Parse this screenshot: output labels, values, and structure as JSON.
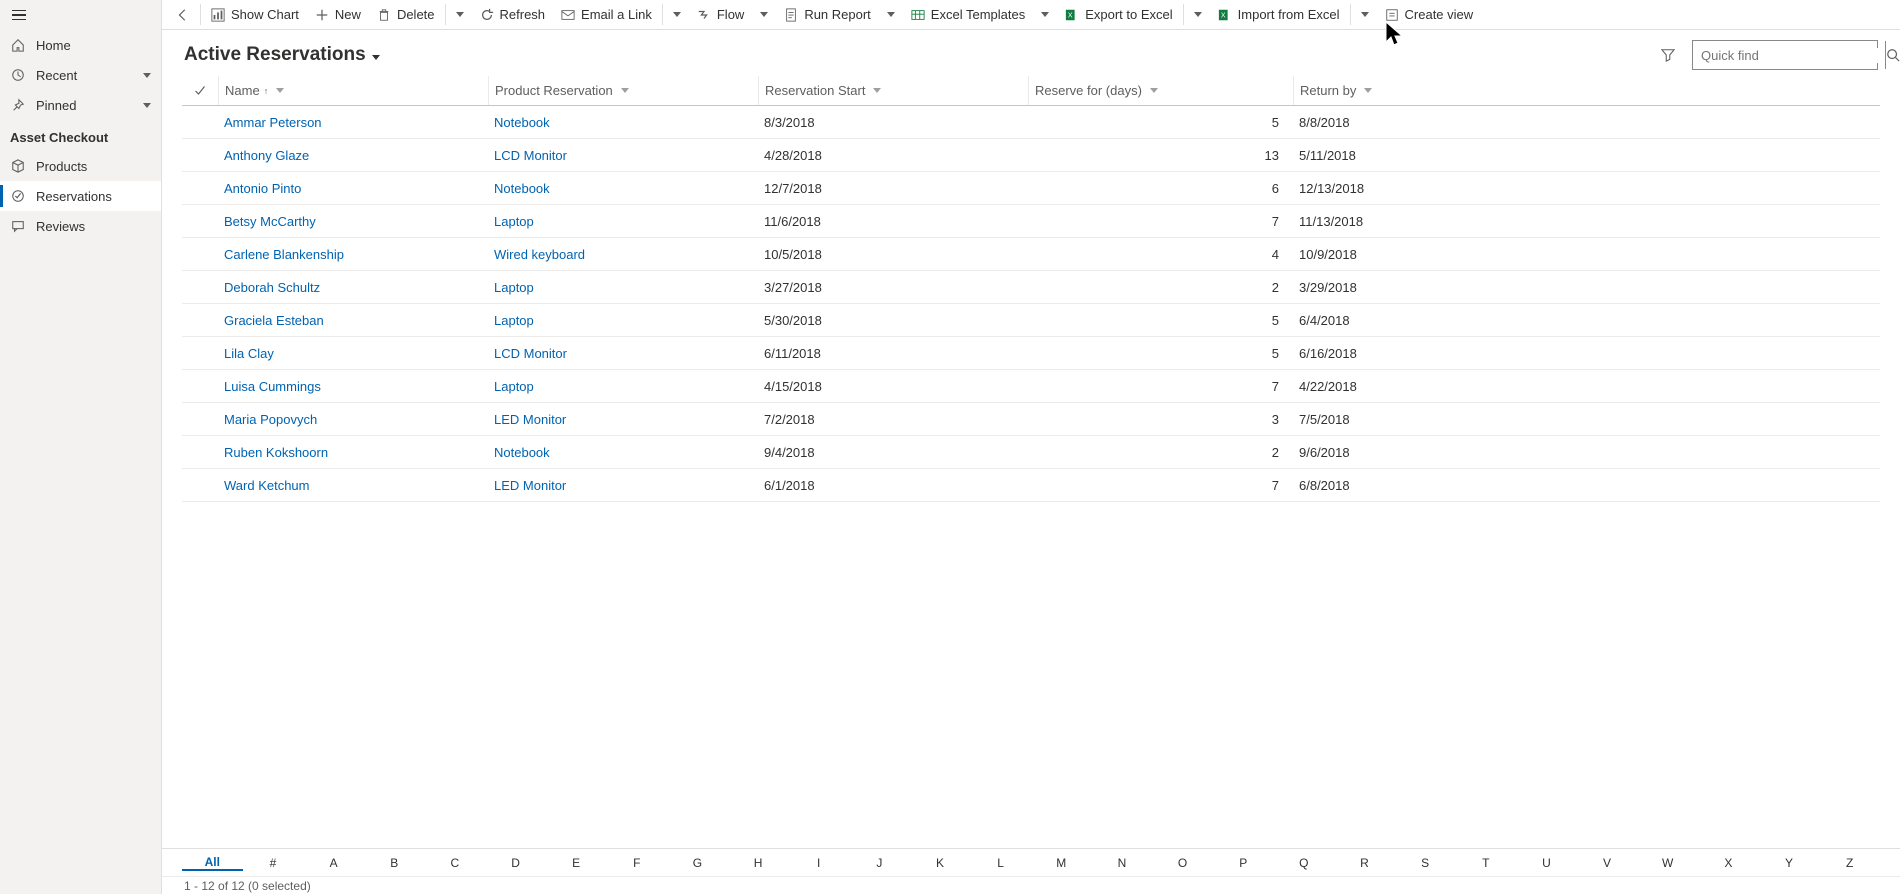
{
  "sidebar": {
    "nav": [
      {
        "icon": "home",
        "label": "Home"
      },
      {
        "icon": "clock",
        "label": "Recent",
        "chevron": true
      },
      {
        "icon": "pin",
        "label": "Pinned",
        "chevron": true
      }
    ],
    "section_label": "Asset Checkout",
    "area": [
      {
        "icon": "cube",
        "label": "Products"
      },
      {
        "icon": "check-circle",
        "label": "Reservations",
        "active": true
      },
      {
        "icon": "comment",
        "label": "Reviews"
      }
    ]
  },
  "toolbar": {
    "show_chart": "Show Chart",
    "new": "New",
    "delete": "Delete",
    "refresh": "Refresh",
    "email": "Email a Link",
    "flow": "Flow",
    "run_report": "Run Report",
    "excel_templates": "Excel Templates",
    "export_excel": "Export to Excel",
    "import_excel": "Import from Excel",
    "create_view": "Create view"
  },
  "header": {
    "view_title": "Active Reservations",
    "quickfind_placeholder": "Quick find"
  },
  "columns": {
    "name": "Name",
    "product": "Product Reservation",
    "start": "Reservation Start",
    "days": "Reserve for (days)",
    "return": "Return by"
  },
  "rows": [
    {
      "name": "Ammar Peterson",
      "product": "Notebook",
      "start": "8/3/2018",
      "days": "5",
      "return": "8/8/2018"
    },
    {
      "name": "Anthony Glaze",
      "product": "LCD Monitor",
      "start": "4/28/2018",
      "days": "13",
      "return": "5/11/2018"
    },
    {
      "name": "Antonio Pinto",
      "product": "Notebook",
      "start": "12/7/2018",
      "days": "6",
      "return": "12/13/2018"
    },
    {
      "name": "Betsy McCarthy",
      "product": "Laptop",
      "start": "11/6/2018",
      "days": "7",
      "return": "11/13/2018"
    },
    {
      "name": "Carlene Blankenship",
      "product": "Wired keyboard",
      "start": "10/5/2018",
      "days": "4",
      "return": "10/9/2018"
    },
    {
      "name": "Deborah Schultz",
      "product": "Laptop",
      "start": "3/27/2018",
      "days": "2",
      "return": "3/29/2018"
    },
    {
      "name": "Graciela Esteban",
      "product": "Laptop",
      "start": "5/30/2018",
      "days": "5",
      "return": "6/4/2018"
    },
    {
      "name": "Lila Clay",
      "product": "LCD Monitor",
      "start": "6/11/2018",
      "days": "5",
      "return": "6/16/2018"
    },
    {
      "name": "Luisa Cummings",
      "product": "Laptop",
      "start": "4/15/2018",
      "days": "7",
      "return": "4/22/2018"
    },
    {
      "name": "Maria Popovych",
      "product": "LED Monitor",
      "start": "7/2/2018",
      "days": "3",
      "return": "7/5/2018"
    },
    {
      "name": "Ruben Kokshoorn",
      "product": "Notebook",
      "start": "9/4/2018",
      "days": "2",
      "return": "9/6/2018"
    },
    {
      "name": "Ward Ketchum",
      "product": "LED Monitor",
      "start": "6/1/2018",
      "days": "7",
      "return": "6/8/2018"
    }
  ],
  "alpha": [
    "All",
    "#",
    "A",
    "B",
    "C",
    "D",
    "E",
    "F",
    "G",
    "H",
    "I",
    "J",
    "K",
    "L",
    "M",
    "N",
    "O",
    "P",
    "Q",
    "R",
    "S",
    "T",
    "U",
    "V",
    "W",
    "X",
    "Y",
    "Z"
  ],
  "footer": {
    "status": "1 - 12 of 12 (0 selected)"
  }
}
